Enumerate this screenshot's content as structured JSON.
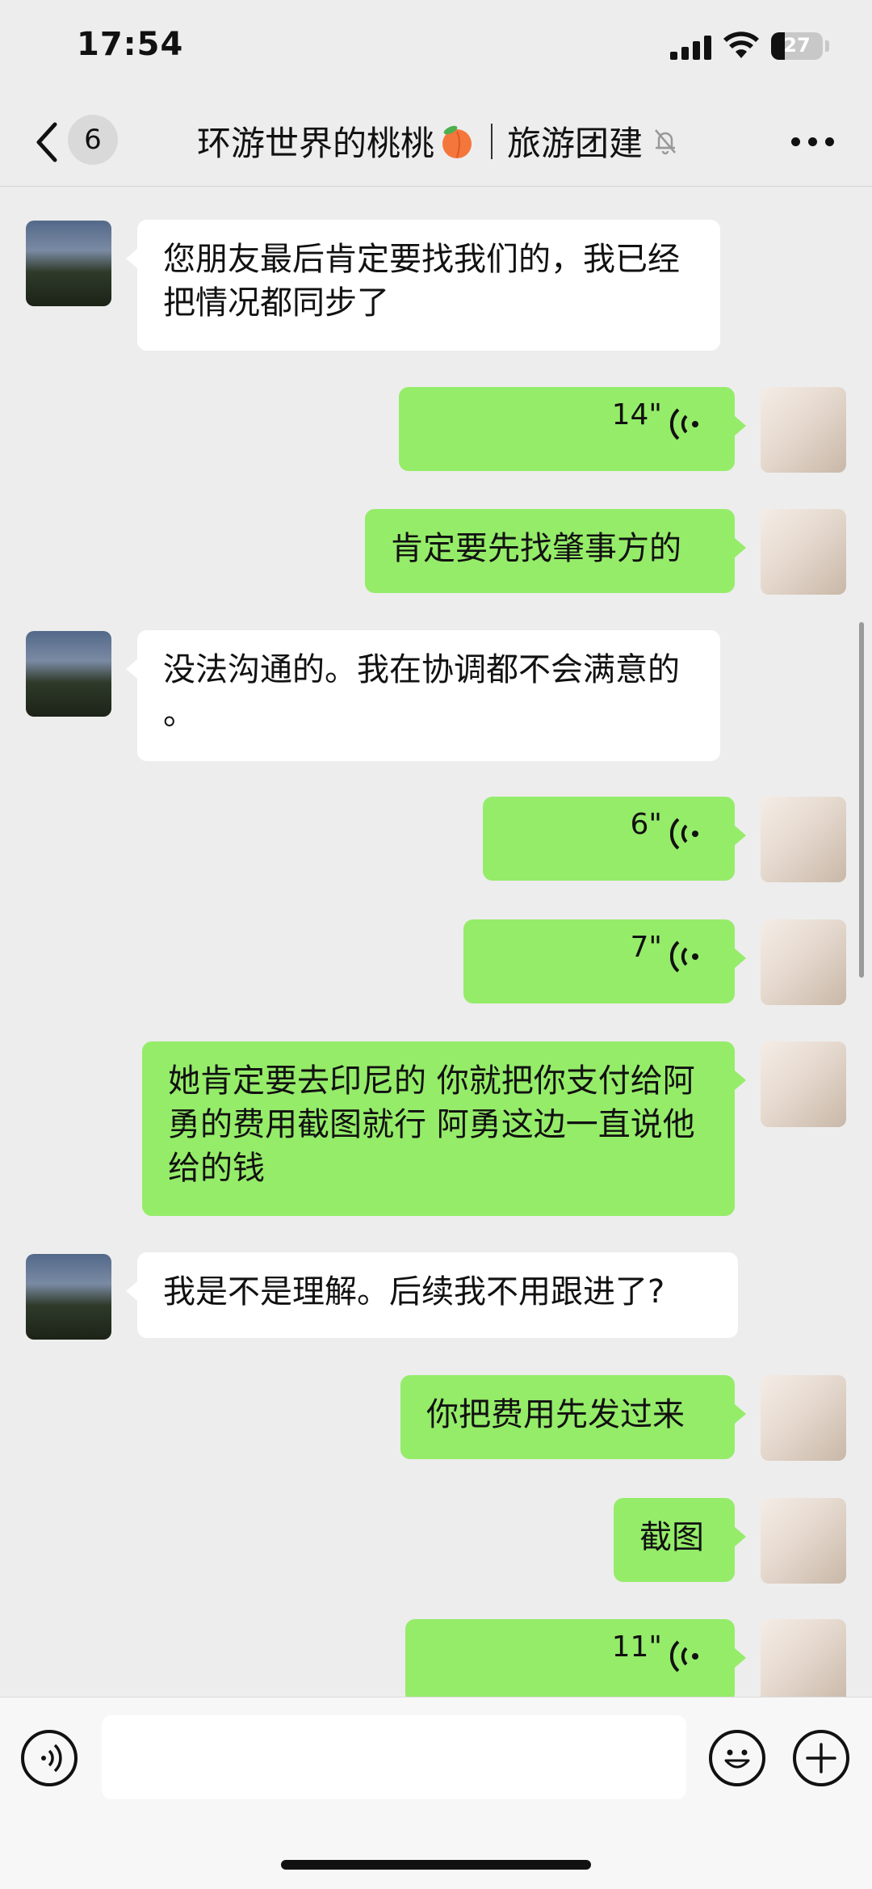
{
  "status_bar": {
    "time": "17:54",
    "battery": "27",
    "battery_percent": 27
  },
  "header": {
    "unread_count": "6",
    "chat_name": "环游世界的桃桃",
    "group_name": "旅游团建"
  },
  "messages": [
    {
      "side": "left",
      "type": "text",
      "text": "您朋友最后肯定要找我们的，我已经把情况都同步了"
    },
    {
      "side": "right",
      "type": "voice",
      "duration": "14\""
    },
    {
      "side": "right",
      "type": "text",
      "text": "肯定要先找肇事方的"
    },
    {
      "side": "left",
      "type": "text",
      "text": "没法沟通的。我在协调都不会满意的 。"
    },
    {
      "side": "right",
      "type": "voice",
      "duration": "6\""
    },
    {
      "side": "right",
      "type": "voice",
      "duration": "7\""
    },
    {
      "side": "right",
      "type": "text",
      "text": "她肯定要去印尼的 你就把你支付给阿勇的费用截图就行 阿勇这边一直说他给的钱"
    },
    {
      "side": "left",
      "type": "text",
      "text": "我是不是理解。后续我不用跟进了?"
    },
    {
      "side": "right",
      "type": "text",
      "text": "你把费用先发过来"
    },
    {
      "side": "right",
      "type": "text",
      "text": "截图"
    },
    {
      "side": "right",
      "type": "voice",
      "duration": "11\""
    }
  ],
  "input_bar": {
    "text": ""
  },
  "colors": {
    "outgoing": "#95ec69",
    "incoming": "#ffffff",
    "background": "#ededed"
  },
  "icons": [
    "back-chevron-icon",
    "peach-emoji-icon",
    "mute-bell-icon",
    "more-dots-icon",
    "voice-wave-icon",
    "voice-input-icon",
    "emoji-icon",
    "plus-icon"
  ]
}
